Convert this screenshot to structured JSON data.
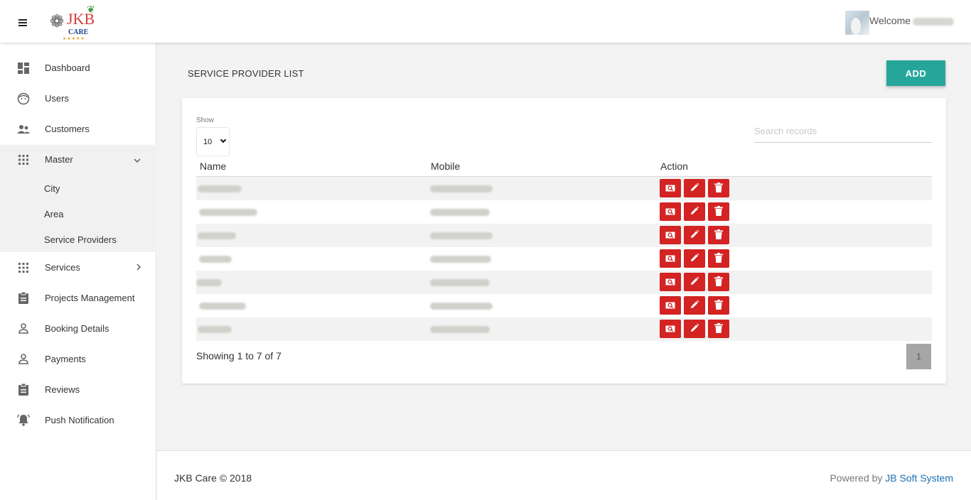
{
  "header": {
    "logo": {
      "main": "JKB",
      "sub": "CARE",
      "stars": "★★★★★"
    },
    "welcome": "Welcome"
  },
  "sidebar": {
    "items": [
      {
        "label": "Dashboard",
        "icon": "dashboard-icon"
      },
      {
        "label": "Users",
        "icon": "face-icon"
      },
      {
        "label": "Customers",
        "icon": "people-icon"
      },
      {
        "label": "Master",
        "icon": "grid-icon",
        "chevron": "chevron-down-icon"
      },
      {
        "label": "Services",
        "icon": "grid-icon",
        "chevron": "chevron-right-icon"
      },
      {
        "label": "Projects Management",
        "icon": "clipboard-icon"
      },
      {
        "label": "Booking Details",
        "icon": "person-icon"
      },
      {
        "label": "Payments",
        "icon": "person-icon"
      },
      {
        "label": "Reviews",
        "icon": "clipboard-icon"
      },
      {
        "label": "Push Notification",
        "icon": "bell-icon"
      }
    ],
    "master_sub": [
      "City",
      "Area",
      "Service Providers"
    ]
  },
  "main": {
    "title": "SERVICE PROVIDER LIST",
    "add_label": "ADD",
    "show_label": "Show",
    "show_value": "10",
    "search_placeholder": "Search records",
    "columns": [
      "Name",
      "Mobile",
      "Action"
    ],
    "row_count": 7,
    "info": "Showing 1 to 7 of 7",
    "page": "1"
  },
  "footer": {
    "copyright": "JKB Care © 2018",
    "powered_prefix": "Powered by ",
    "powered_link": "JB Soft System"
  },
  "colors": {
    "accent": "#26a69a",
    "danger": "#d32323",
    "link": "#1a6fb4"
  }
}
